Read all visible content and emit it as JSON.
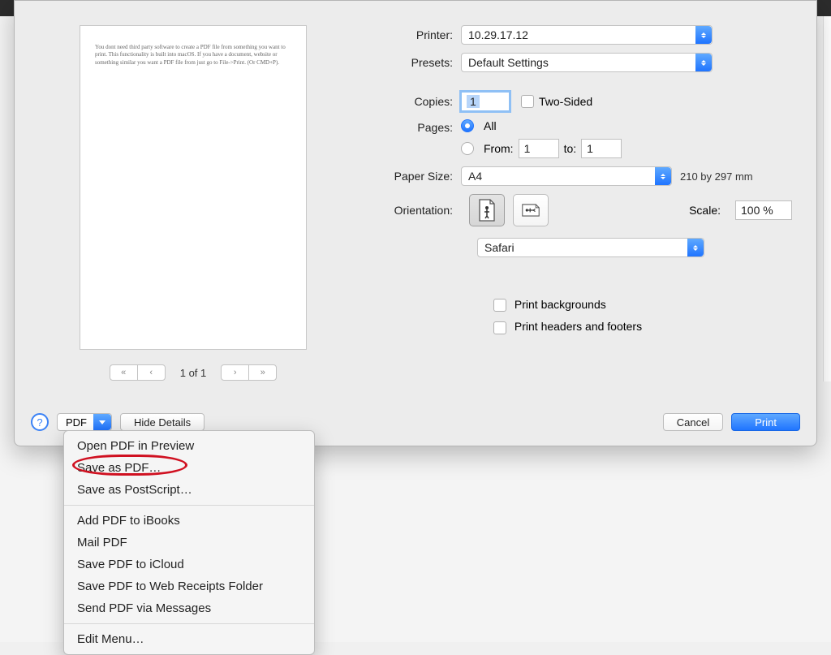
{
  "preview": {
    "doc_text": "You dont need third party software to create a PDF file from something you want to print. This functionality is built into macOS. If you have a document, website or something similar you want a PDF file from just go to File->Print. (Or CMD+P).",
    "page_indicator": "1 of 1"
  },
  "printer": {
    "label": "Printer:",
    "value": "10.29.17.12"
  },
  "presets": {
    "label": "Presets:",
    "value": "Default Settings"
  },
  "copies": {
    "label": "Copies:",
    "value": "1",
    "two_sided_label": "Two-Sided"
  },
  "pages": {
    "label": "Pages:",
    "all_label": "All",
    "from_label": "From:",
    "to_label": "to:",
    "from_value": "1",
    "to_value": "1"
  },
  "paper": {
    "label": "Paper Size:",
    "value": "A4",
    "dims": "210 by 297 mm"
  },
  "orientation": {
    "label": "Orientation:",
    "scale_label": "Scale:",
    "scale_value": "100 %"
  },
  "category": {
    "value": "Safari"
  },
  "print_options": {
    "backgrounds": "Print backgrounds",
    "headers_footers": "Print headers and footers"
  },
  "buttons": {
    "help": "?",
    "pdf": "PDF",
    "hide_details": "Hide Details",
    "cancel": "Cancel",
    "print": "Print"
  },
  "pdf_menu": {
    "open_preview": "Open PDF in Preview",
    "save_as_pdf": "Save as PDF…",
    "save_as_ps": "Save as PostScript…",
    "add_ibooks": "Add PDF to iBooks",
    "mail_pdf": "Mail PDF",
    "save_icloud": "Save PDF to iCloud",
    "save_receipts": "Save PDF to Web Receipts Folder",
    "send_messages": "Send PDF via Messages",
    "edit_menu": "Edit Menu…"
  }
}
